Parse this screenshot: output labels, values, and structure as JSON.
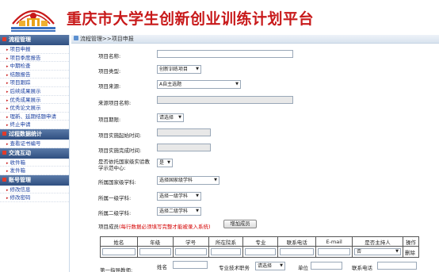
{
  "header": {
    "title": "重庆市大学生创新创业训练计划平台"
  },
  "sidebar": {
    "sections": [
      {
        "title": "流程管理",
        "items": [
          "项目申报",
          "项目季度报告",
          "中期检查",
          "结题报告",
          "项目跟踪",
          "后续成果展示",
          "优秀成果展示",
          "优秀论文展示",
          "理新、延期结题申请",
          "终止申请"
        ]
      },
      {
        "title": "过程数据统计",
        "items": [
          "查看证书编号"
        ]
      },
      {
        "title": "交流互动",
        "items": [
          "收件箱",
          "发件箱"
        ]
      },
      {
        "title": "账号管理",
        "items": [
          "修改信息",
          "修改密码"
        ]
      }
    ]
  },
  "breadcrumb": "流程管理>>项目申报",
  "form": {
    "project_name_label": "项目名称:",
    "project_type_label": "项目类型:",
    "project_type_value": "创新训练项目",
    "project_source_label": "项目来源:",
    "project_source_value": "A自主选题",
    "source_name_label": "来源项目名称:",
    "period_label": "项目期限:",
    "period_value": "请选择",
    "start_label": "项目实施起始时间:",
    "end_label": "项目实施完成时间:",
    "rely_label_1": "是否依托国家级实验教",
    "rely_label_2": "学示范中心:",
    "rely_value": "是",
    "national_label": "所属国家级学科:",
    "national_value": "选择国家级学科",
    "level1_label": "所属一级学科:",
    "level1_value": "选择一级学科",
    "level2_label": "所属二级学科:",
    "level2_value": "选择二级学科",
    "members_label": "项目成员",
    "members_note": "(每行数据必须填写完整才能被录入系统)",
    "add_member_button": "增加成员"
  },
  "table": {
    "headers": [
      "姓名",
      "年级",
      "学号",
      "所在院系",
      "专业",
      "联系电话",
      "E-mail",
      "是否主持人",
      "操作"
    ],
    "host_value": "否",
    "delete_label": "删除"
  },
  "footer_row": {
    "advisor_label": "第一指导教师:",
    "name_label": "姓名",
    "title_label": "专业技术职务",
    "title_value": "请选择",
    "unit_label": "单位",
    "phone_label": "联系电话"
  }
}
